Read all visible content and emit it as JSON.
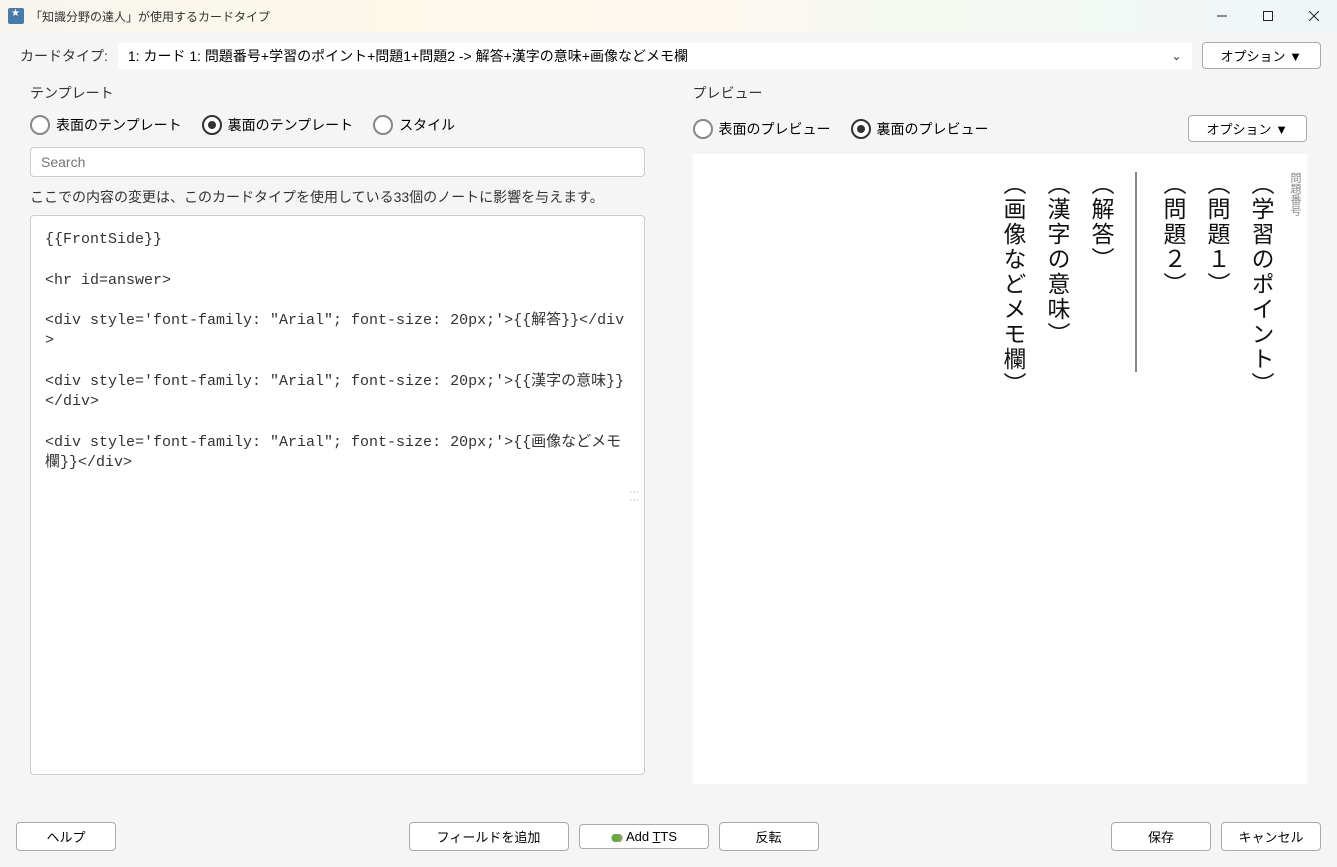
{
  "window": {
    "title": "「知識分野の達人」が使用するカードタイプ"
  },
  "toolbar": {
    "card_type_label": "カードタイプ:",
    "card_type_value": "1: カード 1: 問題番号+学習のポイント+問題1+問題2 -> 解答+漢字の意味+画像などメモ欄",
    "option_label": "オプション ▼"
  },
  "template": {
    "title": "テンプレート",
    "radios": {
      "front": "表面のテンプレート",
      "back": "裏面のテンプレート",
      "style": "スタイル"
    },
    "search_placeholder": "Search",
    "info": "ここでの内容の変更は、このカードタイプを使用している33個のノートに影響を与えます。",
    "code": "{{FrontSide}}\n\n<hr id=answer>\n\n<div style='font-family: \"Arial\"; font-size: 20px;'>{{解答}}</div>\n\n<div style='font-family: \"Arial\"; font-size: 20px;'>{{漢字の意味}}</div>\n\n<div style='font-family: \"Arial\"; font-size: 20px;'>{{画像などメモ欄}}</div>"
  },
  "preview": {
    "title": "プレビュー",
    "radios": {
      "front": "表面のプレビュー",
      "back": "裏面のプレビュー"
    },
    "option_label": "オプション ▼",
    "fields": {
      "num_label": "問題番号",
      "point": "︵学習のポイント︶",
      "q1": "︵問題１︶",
      "q2": "︵問題２︶",
      "answer": "︵解答︶",
      "meaning": "︵漢字の意味︶",
      "memo": "︵画像などメモ欄︶"
    }
  },
  "footer": {
    "help": "ヘルプ",
    "add_field": "フィールドを追加",
    "add_tts": "Add TTS",
    "flip": "反転",
    "save": "保存",
    "cancel": "キャンセル"
  }
}
